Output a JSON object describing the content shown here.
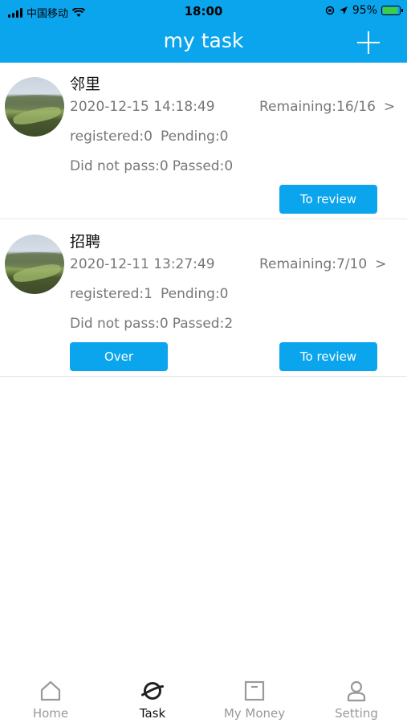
{
  "status_bar": {
    "carrier": "中国移动",
    "time": "18:00",
    "battery": "95%"
  },
  "nav": {
    "title": "my task",
    "add_icon": "plus-icon"
  },
  "tasks": [
    {
      "title": "邻里",
      "date": "2020-12-15 14:18:49",
      "remaining": "Remaining:16/16",
      "arrow": ">",
      "registered": "registered:0",
      "pending": "Pending:0",
      "did_not_pass": "Did not pass:0",
      "passed": "Passed:0",
      "review_label": "To review"
    },
    {
      "title": "招聘",
      "date": "2020-12-11 13:27:49",
      "remaining": "Remaining:7/10",
      "arrow": ">",
      "registered": "registered:1",
      "pending": "Pending:0",
      "did_not_pass": "Did not pass:0",
      "passed": "Passed:2",
      "over_label": "Over",
      "review_label": "To review"
    }
  ],
  "tab_bar": {
    "items": [
      {
        "label": "Home",
        "icon": "home-icon",
        "active": false
      },
      {
        "label": "Task",
        "icon": "task-icon",
        "active": true
      },
      {
        "label": "My Money",
        "icon": "money-icon",
        "active": false
      },
      {
        "label": "Setting",
        "icon": "user-icon",
        "active": false
      }
    ]
  },
  "colors": {
    "accent": "#0ba5ee",
    "text_secondary": "#777777",
    "tab_inactive": "#999999"
  }
}
